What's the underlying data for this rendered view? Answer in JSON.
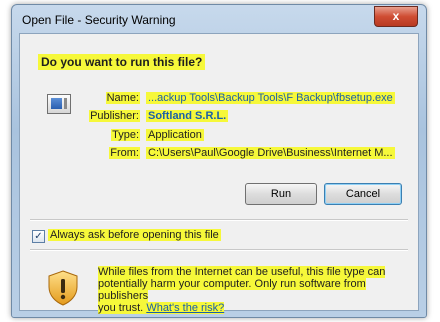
{
  "window": {
    "title": "Open File - Security Warning",
    "close_glyph": "x"
  },
  "question": "Do you want to run this file?",
  "details": {
    "name_label": "Name:",
    "name_value": "...ackup Tools\\Backup Tools\\F Backup\\fbsetup.exe",
    "publisher_label": "Publisher:",
    "publisher_value": "Softland S.R.L.",
    "type_label": "Type:",
    "type_value": "Application",
    "from_label": "From:",
    "from_value": "C:\\Users\\Paul\\Google Drive\\Business\\Internet M..."
  },
  "buttons": {
    "run": "Run",
    "cancel": "Cancel"
  },
  "checkbox": {
    "label": "Always ask before opening this file",
    "checked": true,
    "mark": "✓"
  },
  "warning": {
    "line1": "While files from the Internet can be useful, this file type can",
    "line2": "potentially harm your computer. Only run software from publishers",
    "line3_prefix": "you trust.",
    "link": "What's the risk?"
  },
  "icons": {
    "file": "application-file-icon",
    "shield": "warning-shield-icon",
    "close": "close-icon"
  },
  "colors": {
    "highlight": "#f6f83a",
    "link": "#1a5fa8",
    "close_button": "#cf4d33"
  }
}
